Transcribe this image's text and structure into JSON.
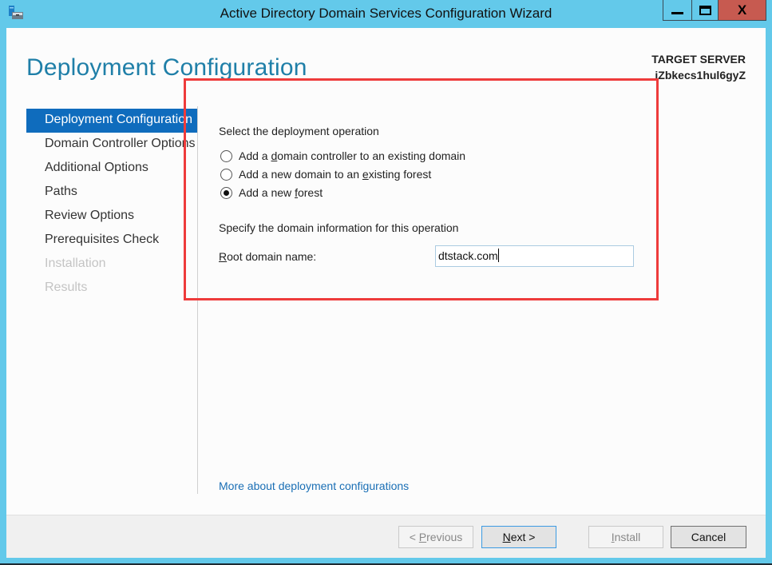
{
  "window": {
    "title": "Active Directory Domain Services Configuration Wizard",
    "controls": {
      "minimize": "minimize",
      "maximize": "maximize",
      "close": "X"
    }
  },
  "header": {
    "page_title": "Deployment Configuration",
    "target_server_label": "TARGET SERVER",
    "target_server_name": "iZbkecs1hul6gyZ"
  },
  "nav": {
    "items": [
      {
        "label": "Deployment Configuration",
        "state": "active"
      },
      {
        "label": "Domain Controller Options",
        "state": "normal"
      },
      {
        "label": "Additional Options",
        "state": "normal"
      },
      {
        "label": "Paths",
        "state": "normal"
      },
      {
        "label": "Review Options",
        "state": "normal"
      },
      {
        "label": "Prerequisites Check",
        "state": "normal"
      },
      {
        "label": "Installation",
        "state": "disabled"
      },
      {
        "label": "Results",
        "state": "disabled"
      }
    ]
  },
  "main": {
    "operation_heading": "Select the deployment operation",
    "options": [
      {
        "pre": "Add a ",
        "accel": "d",
        "post": "omain controller to an existing domain",
        "checked": false
      },
      {
        "pre": "Add a new domain to an ",
        "accel": "e",
        "post": "xisting forest",
        "checked": false
      },
      {
        "pre": "Add a new ",
        "accel": "f",
        "post": "orest",
        "checked": true
      }
    ],
    "domain_info_heading": "Specify the domain information for this operation",
    "root_domain": {
      "label_accel": "R",
      "label_rest": "oot domain name:",
      "value": "dtstack.com"
    },
    "more_link": "More about deployment configurations"
  },
  "footer": {
    "previous": {
      "pre": "< ",
      "accel": "P",
      "post": "revious",
      "enabled": false
    },
    "next": {
      "accel": "N",
      "post": "ext >",
      "enabled": true
    },
    "install": {
      "accel": "I",
      "post": "nstall",
      "enabled": false
    },
    "cancel": {
      "label": "Cancel",
      "enabled": true
    }
  },
  "colors": {
    "chrome": "#63c9ea",
    "accent": "#0f6cbd",
    "title": "#1f7fa8",
    "link": "#1a6fb5",
    "close_button": "#c75a50",
    "highlight": "#ee3b3b"
  }
}
